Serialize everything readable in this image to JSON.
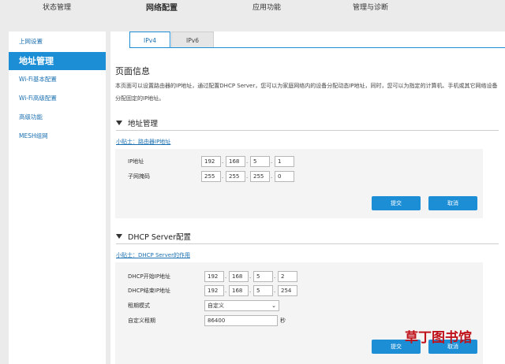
{
  "top_nav": [
    {
      "label": "状态管理",
      "active": false
    },
    {
      "label": "网络配置",
      "active": true
    },
    {
      "label": "应用功能",
      "active": false
    },
    {
      "label": "管理与诊断",
      "active": false
    }
  ],
  "sidebar": {
    "items": [
      {
        "label": "上网设置"
      },
      {
        "label": "地址管理",
        "active": true
      },
      {
        "label": "Wi-Fi基本配置"
      },
      {
        "label": "Wi-Fi高级配置"
      },
      {
        "label": "高级功能"
      },
      {
        "label": "MESH组网"
      }
    ]
  },
  "tabs": [
    {
      "label": "IPv4",
      "active": true
    },
    {
      "label": "IPv6",
      "active": false
    }
  ],
  "page": {
    "title": "页面信息",
    "description": "本页面可以设置路由器的IP地址，通过配置DHCP Server，您可以为家庭网络内的设备分配动态IP地址，同时，您可以为指定的计算机、手机或其它网络设备分配固定的IP地址。"
  },
  "address_section": {
    "title": "地址管理",
    "tip": "小贴士：路由器IP地址",
    "ip_label": "IP地址",
    "ip": [
      "192",
      "168",
      "5",
      "1"
    ],
    "mask_label": "子网掩码",
    "mask": [
      "255",
      "255",
      "255",
      "0"
    ],
    "submit": "提交",
    "cancel": "取消"
  },
  "dhcp_section": {
    "title": "DHCP Server配置",
    "tip": "小贴士：DHCP Server的作用",
    "start_label": "DHCP开始IP地址",
    "start_ip": [
      "192",
      "168",
      "5",
      "2"
    ],
    "end_label": "DHCP结束IP地址",
    "end_ip": [
      "192",
      "168",
      "5",
      "254"
    ],
    "lease_mode_label": "租期模式",
    "lease_mode_value": "自定义",
    "custom_lease_label": "自定义租期",
    "custom_lease_value": "86400",
    "lease_unit": "秒",
    "submit": "提交",
    "cancel": "取消"
  },
  "watermark": {
    "text": "草丁图书馆"
  },
  "colors": {
    "accent": "#1c8ed6",
    "link": "#1a6fb0",
    "watermark": "#c0121a"
  }
}
